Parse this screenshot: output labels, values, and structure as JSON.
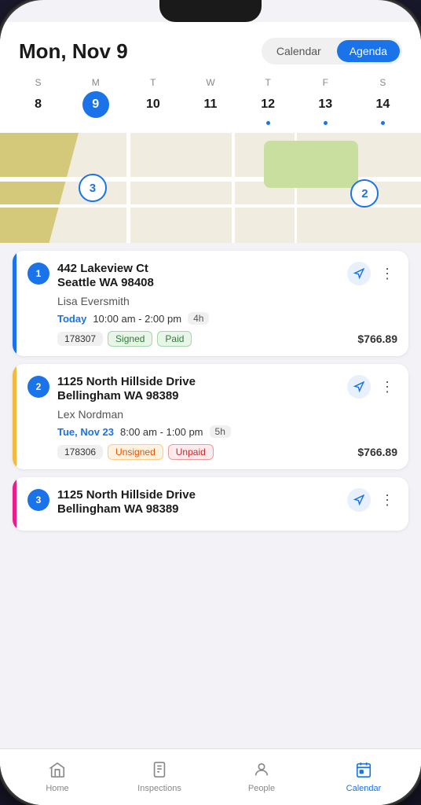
{
  "header": {
    "title": "Mon, Nov 9",
    "btn_calendar": "Calendar",
    "btn_agenda": "Agenda"
  },
  "week": {
    "days": [
      {
        "letter": "S",
        "number": "8",
        "active": false,
        "dot": false
      },
      {
        "letter": "M",
        "number": "9",
        "active": true,
        "dot": false
      },
      {
        "letter": "T",
        "number": "10",
        "active": false,
        "dot": false
      },
      {
        "letter": "W",
        "number": "11",
        "active": false,
        "dot": false
      },
      {
        "letter": "T",
        "number": "12",
        "active": false,
        "dot": true
      },
      {
        "letter": "F",
        "number": "13",
        "active": false,
        "dot": true
      },
      {
        "letter": "S",
        "number": "14",
        "active": false,
        "dot": true
      }
    ]
  },
  "map": {
    "pin1_label": "3",
    "pin2_label": "2"
  },
  "inspections": [
    {
      "number": "1",
      "address_line1": "442 Lakeview Ct",
      "address_line2": "Seattle WA 98408",
      "client": "Lisa Eversmith",
      "date_label": "Today",
      "time_range": "10:00 am - 2:00 pm",
      "duration": "4h",
      "id_badge": "178307",
      "status_badge": "Signed",
      "payment_badge": "Paid",
      "price": "$766.89",
      "accent_color": "#1a73e8",
      "status_type": "signed",
      "payment_type": "paid"
    },
    {
      "number": "2",
      "address_line1": "1125 North Hillside Drive",
      "address_line2": "Bellingham WA 98389",
      "client": "Lex Nordman",
      "date_label": "Tue, Nov 23",
      "time_range": "8:00 am - 1:00 pm",
      "duration": "5h",
      "id_badge": "178306",
      "status_badge": "Unsigned",
      "payment_badge": "Unpaid",
      "price": "$766.89",
      "accent_color": "#f4b942",
      "status_type": "unsigned",
      "payment_type": "unpaid"
    },
    {
      "number": "3",
      "address_line1": "1125 North Hillside Drive",
      "address_line2": "Bellingham WA 98389",
      "client": "",
      "date_label": "",
      "time_range": "",
      "duration": "",
      "id_badge": "",
      "status_badge": "",
      "payment_badge": "",
      "price": "",
      "accent_color": "#e91e8c",
      "status_type": "",
      "payment_type": ""
    }
  ],
  "nav": {
    "items": [
      {
        "label": "Home",
        "icon": "⌂",
        "active": false
      },
      {
        "label": "Inspections",
        "icon": "☰",
        "active": false
      },
      {
        "label": "People",
        "icon": "👤",
        "active": false
      },
      {
        "label": "Calendar",
        "icon": "📅",
        "active": true
      }
    ]
  }
}
